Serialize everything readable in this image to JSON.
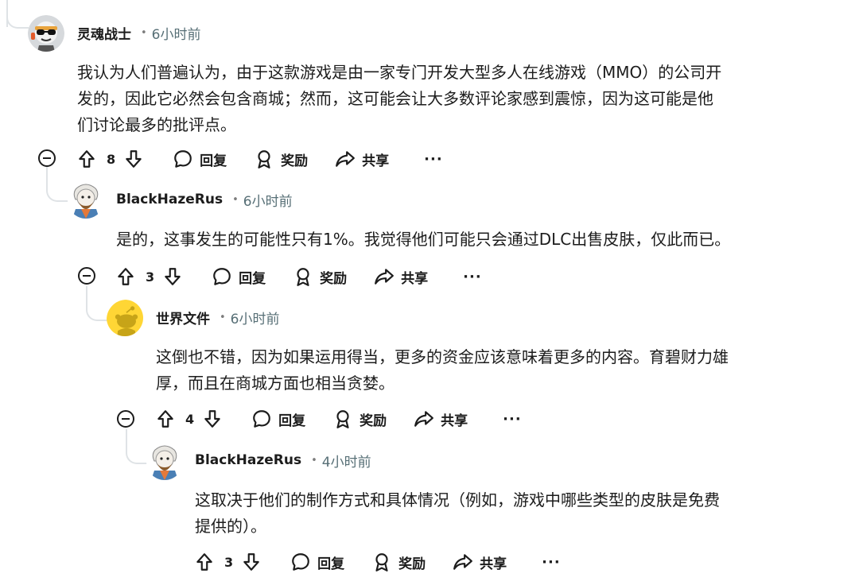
{
  "comments": [
    {
      "username": "灵魂战士",
      "separator": "•",
      "time": "6小时前",
      "body_lines": [
        "我认为人们普遍认为，由于这款游戏是由一家专门开发大型多人在线游戏（MMO）的公司开",
        "发的，因此它必然会包含商城；然而，这可能会让大多数评论家感到震惊，因为这可能是他",
        "们讨论最多的批评点。"
      ],
      "score": "8",
      "reply_label": "回复",
      "award_label": "奖励",
      "share_label": "共享",
      "more_label": "···",
      "avatar_icon": "sunglasses-avatar-icon"
    },
    {
      "username": "BlackHazeRus",
      "separator": "•",
      "time": "6小时前",
      "body_lines": [
        "是的，这事发生的可能性只有1%。我觉得他们可能只会通过DLC出售皮肤，仅此而已。"
      ],
      "score": "3",
      "reply_label": "回复",
      "award_label": "奖励",
      "share_label": "共享",
      "more_label": "···",
      "avatar_icon": "bearded-avatar-icon"
    },
    {
      "username": "世界文件",
      "separator": "•",
      "time": "6小时前",
      "body_lines": [
        "这倒也不错，因为如果运用得当，更多的资金应该意味着更多的内容。育碧财力雄",
        "厚，而且在商城方面也相当贪婪。"
      ],
      "score": "4",
      "reply_label": "回复",
      "award_label": "奖励",
      "share_label": "共享",
      "more_label": "···",
      "avatar_icon": "default-snoo-avatar-icon"
    },
    {
      "username": "BlackHazeRus",
      "separator": "•",
      "time": "4小时前",
      "body_lines": [
        "这取决于他们的制作方式和具体情况（例如，游戏中哪些类型的皮肤是免费",
        "提供的）。"
      ],
      "score": "3",
      "reply_label": "回复",
      "award_label": "奖励",
      "share_label": "共享",
      "more_label": "···",
      "avatar_icon": "bearded-avatar-icon"
    }
  ],
  "colors": {
    "thread_line": "#dfe3e6",
    "text": "#1c1c1c",
    "meta": "#576f76",
    "snoo_yellow": "#ffd635"
  }
}
